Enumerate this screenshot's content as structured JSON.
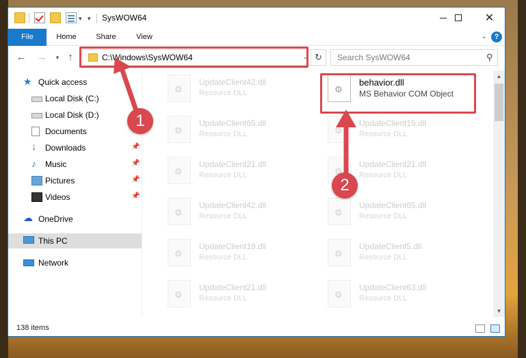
{
  "window": {
    "title": "SysWOW64"
  },
  "ribbon": {
    "tabs": [
      "File",
      "Home",
      "Share",
      "View"
    ]
  },
  "address": {
    "path": "C:\\Windows\\SysWOW64",
    "refresh_icon": "↻",
    "dropdown_icon": "⌄"
  },
  "search": {
    "placeholder": "Search SysWOW64"
  },
  "sidebar": {
    "items": [
      {
        "label": "Quick access",
        "icon": "star-icon"
      },
      {
        "label": "Local Disk (C:)",
        "icon": "drive-icon"
      },
      {
        "label": "Local Disk (D:)",
        "icon": "drive-icon"
      },
      {
        "label": "Documents",
        "icon": "documents-icon"
      },
      {
        "label": "Downloads",
        "icon": "downloads-icon"
      },
      {
        "label": "Music",
        "icon": "music-icon"
      },
      {
        "label": "Pictures",
        "icon": "pictures-icon"
      },
      {
        "label": "Videos",
        "icon": "videos-icon"
      },
      {
        "label": "OneDrive",
        "icon": "cloud-icon"
      },
      {
        "label": "This PC",
        "icon": "computer-icon",
        "selected": true
      },
      {
        "label": "Network",
        "icon": "network-icon"
      }
    ]
  },
  "files": [
    {
      "name": "UpdateClient42.dll",
      "desc": "Resource DLL"
    },
    {
      "name": "behavior.dll",
      "desc": "MS Behavior COM Object"
    },
    {
      "name": "UpdateClient65.dll",
      "desc": "Resource DLL"
    },
    {
      "name": "UpdateClient19.dll",
      "desc": "Resource DLL"
    },
    {
      "name": "UpdateClient21.dll",
      "desc": "Resource DLL"
    },
    {
      "name": "UpdateClient21.dll",
      "desc": "Resource DLL"
    },
    {
      "name": "UpdateClient42.dll",
      "desc": "Resource DLL"
    },
    {
      "name": "UpdateClient65.dll",
      "desc": "Resource DLL"
    },
    {
      "name": "UpdateClient19.dll",
      "desc": "Resource DLL"
    },
    {
      "name": "UpdateClient5.dll",
      "desc": "Resource DLL"
    },
    {
      "name": "UpdateClient21.dll",
      "desc": "Resource DLL"
    },
    {
      "name": "UpdateClient63.dll",
      "desc": "Resource DLL"
    }
  ],
  "status": {
    "item_count": "138 items"
  },
  "annotations": {
    "badge1": "1",
    "badge2": "2",
    "color": "#d9474f"
  },
  "colors": {
    "accent": "#1979ca",
    "highlight": "#d9474f"
  }
}
